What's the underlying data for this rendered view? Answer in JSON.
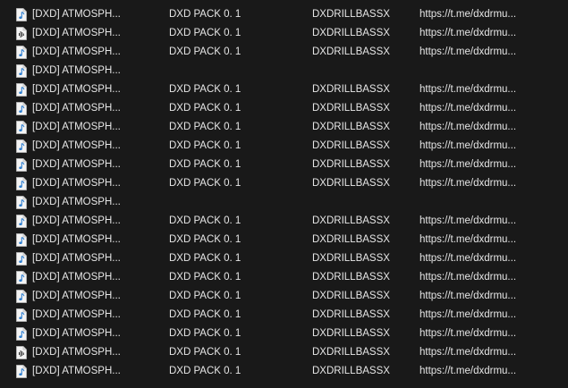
{
  "rows": [
    {
      "icon": "music-file-icon",
      "name": "[DXD] ATMOSPH...",
      "album": "DXD PACK 0. 1",
      "artist": "DXDRILLBASSX",
      "comment": "https://t.me/dxdrmu..."
    },
    {
      "icon": "wave-file-icon",
      "name": "[DXD] ATMOSPH...",
      "album": "DXD PACK 0. 1",
      "artist": "DXDRILLBASSX",
      "comment": "https://t.me/dxdrmu..."
    },
    {
      "icon": "music-file-icon",
      "name": "[DXD] ATMOSPH...",
      "album": "DXD PACK 0. 1",
      "artist": "DXDRILLBASSX",
      "comment": "https://t.me/dxdrmu..."
    },
    {
      "icon": "music-file-icon",
      "name": "[DXD] ATMOSPH...",
      "album": "",
      "artist": "",
      "comment": ""
    },
    {
      "icon": "music-file-icon",
      "name": "[DXD] ATMOSPH...",
      "album": "DXD PACK 0. 1",
      "artist": "DXDRILLBASSX",
      "comment": "https://t.me/dxdrmu..."
    },
    {
      "icon": "music-file-icon",
      "name": "[DXD] ATMOSPH...",
      "album": "DXD PACK 0. 1",
      "artist": "DXDRILLBASSX",
      "comment": "https://t.me/dxdrmu..."
    },
    {
      "icon": "music-file-icon",
      "name": "[DXD] ATMOSPH...",
      "album": "DXD PACK 0. 1",
      "artist": "DXDRILLBASSX",
      "comment": "https://t.me/dxdrmu..."
    },
    {
      "icon": "music-file-icon",
      "name": "[DXD] ATMOSPH...",
      "album": "DXD PACK 0. 1",
      "artist": "DXDRILLBASSX",
      "comment": "https://t.me/dxdrmu..."
    },
    {
      "icon": "music-file-icon",
      "name": "[DXD] ATMOSPH...",
      "album": "DXD PACK 0. 1",
      "artist": "DXDRILLBASSX",
      "comment": "https://t.me/dxdrmu..."
    },
    {
      "icon": "music-file-icon",
      "name": "[DXD] ATMOSPH...",
      "album": "DXD PACK 0. 1",
      "artist": "DXDRILLBASSX",
      "comment": "https://t.me/dxdrmu..."
    },
    {
      "icon": "music-file-icon",
      "name": "[DXD] ATMOSPH...",
      "album": "",
      "artist": "",
      "comment": ""
    },
    {
      "icon": "music-file-icon",
      "name": "[DXD] ATMOSPH...",
      "album": "DXD PACK 0. 1",
      "artist": "DXDRILLBASSX",
      "comment": "https://t.me/dxdrmu..."
    },
    {
      "icon": "music-file-icon",
      "name": "[DXD] ATMOSPH...",
      "album": "DXD PACK 0. 1",
      "artist": "DXDRILLBASSX",
      "comment": "https://t.me/dxdrmu..."
    },
    {
      "icon": "music-file-icon",
      "name": "[DXD] ATMOSPH...",
      "album": "DXD PACK 0. 1",
      "artist": "DXDRILLBASSX",
      "comment": "https://t.me/dxdrmu..."
    },
    {
      "icon": "music-file-icon",
      "name": "[DXD] ATMOSPH...",
      "album": "DXD PACK 0. 1",
      "artist": "DXDRILLBASSX",
      "comment": "https://t.me/dxdrmu..."
    },
    {
      "icon": "music-file-icon",
      "name": "[DXD] ATMOSPH...",
      "album": "DXD PACK 0. 1",
      "artist": "DXDRILLBASSX",
      "comment": "https://t.me/dxdrmu..."
    },
    {
      "icon": "music-file-icon",
      "name": "[DXD] ATMOSPH...",
      "album": "DXD PACK 0. 1",
      "artist": "DXDRILLBASSX",
      "comment": "https://t.me/dxdrmu..."
    },
    {
      "icon": "music-file-icon",
      "name": "[DXD] ATMOSPH...",
      "album": "DXD PACK 0. 1",
      "artist": "DXDRILLBASSX",
      "comment": "https://t.me/dxdrmu..."
    },
    {
      "icon": "wave-file-icon",
      "name": "[DXD] ATMOSPH...",
      "album": "DXD PACK 0. 1",
      "artist": "DXDRILLBASSX",
      "comment": "https://t.me/dxdrmu..."
    },
    {
      "icon": "music-file-icon",
      "name": "[DXD] ATMOSPH...",
      "album": "DXD PACK 0. 1",
      "artist": "DXDRILLBASSX",
      "comment": "https://t.me/dxdrmu..."
    }
  ],
  "colors": {
    "background": "#191919",
    "text": "#e6e6e6",
    "icon_accent": "#2f7fd0"
  }
}
